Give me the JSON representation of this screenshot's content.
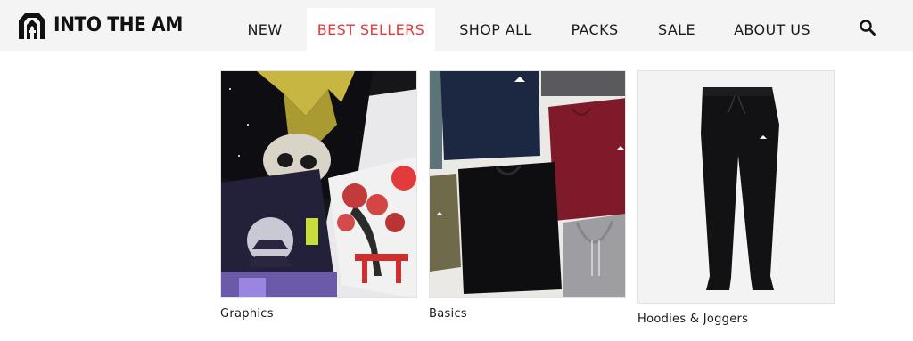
{
  "brand": {
    "name": "INTO THE AM"
  },
  "nav": {
    "items": [
      {
        "label": "NEW"
      },
      {
        "label": "BEST SELLERS",
        "active": true
      },
      {
        "label": "SHOP ALL"
      },
      {
        "label": "PACKS"
      },
      {
        "label": "SALE"
      },
      {
        "label": "ABOUT US"
      }
    ],
    "search_icon": "search-icon",
    "active_color": "#e23a3a"
  },
  "categories": [
    {
      "label": "Graphics"
    },
    {
      "label": "Basics"
    },
    {
      "label": "Hoodies & Joggers"
    }
  ]
}
